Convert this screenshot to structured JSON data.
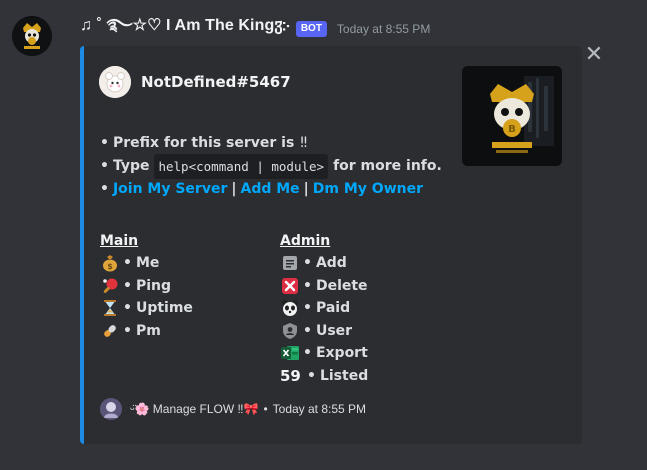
{
  "message": {
    "username": "♫ ˚ ࿐☆♡ I Am The Kingჳ჻",
    "badge": "BOT",
    "timestamp": "Today at 8:55 PM"
  },
  "embed": {
    "accent_color": "#1c8be6",
    "author": "NotDefined#5467",
    "description": {
      "line1_text": "Prefix for this server is",
      "line1_prefix": "‼",
      "line2_pre": "Type",
      "line2_code": "help<command | module>",
      "line2_post": "for more info.",
      "links": [
        "Join My Server",
        "Add Me",
        "Dm My Owner"
      ],
      "separator": "|"
    },
    "fields": [
      {
        "name": "Main",
        "items": [
          {
            "icon": "money-bag-icon",
            "label": "Me"
          },
          {
            "icon": "ping-pong-icon",
            "label": "Ping"
          },
          {
            "icon": "hourglass-icon",
            "label": "Uptime"
          },
          {
            "icon": "pill-icon",
            "label": "Pm"
          }
        ]
      },
      {
        "name": "Admin",
        "items": [
          {
            "icon": "memo-icon",
            "label": "Add"
          },
          {
            "icon": "cross-mark-icon",
            "label": "Delete"
          },
          {
            "icon": "panda-icon",
            "label": "Paid"
          },
          {
            "icon": "user-shield-icon",
            "label": "User"
          },
          {
            "icon": "excel-icon",
            "label": "Export"
          },
          {
            "icon": "number-59-emoji",
            "label": "Listed",
            "emoji_text": "59"
          }
        ]
      }
    ],
    "footer": {
      "text": "ᵕ̈🌸 Manage FLOW ‼🎀",
      "dot": "•",
      "timestamp": "Today at 8:55 PM"
    }
  },
  "close_symbol": "✕",
  "bullet_symbol": "•"
}
